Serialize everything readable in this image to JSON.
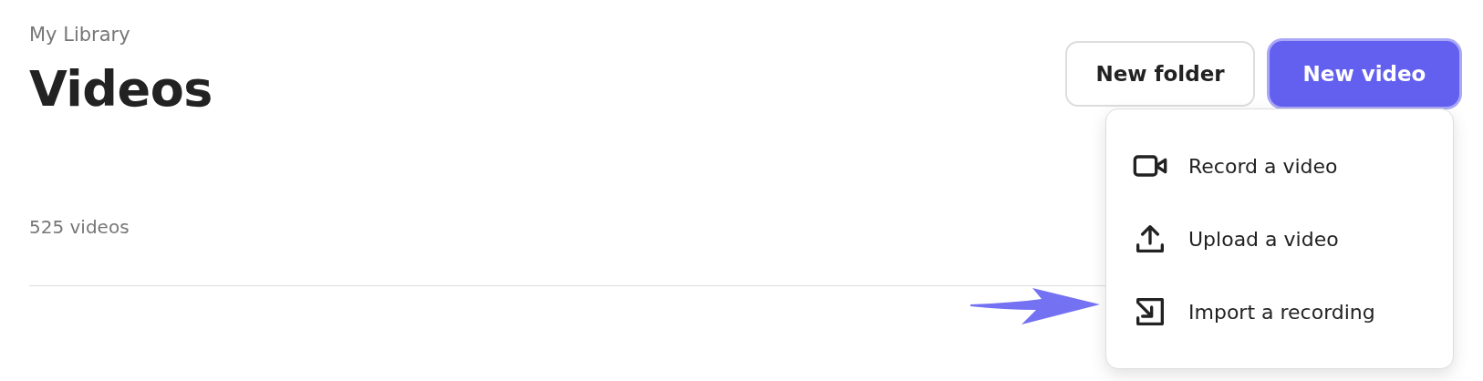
{
  "breadcrumb": "My Library",
  "title": "Videos",
  "count": "525 videos",
  "buttons": [
    {
      "label": "New folder",
      "kind": "secondary"
    },
    {
      "label": "New video",
      "kind": "primary",
      "focused": true
    }
  ],
  "menu": {
    "items": [
      {
        "label": "Record a video",
        "kind": "camera"
      },
      {
        "label": "Upload a video",
        "kind": "upload"
      },
      {
        "label": "Import a recording",
        "kind": "import",
        "pointed": true
      }
    ]
  }
}
